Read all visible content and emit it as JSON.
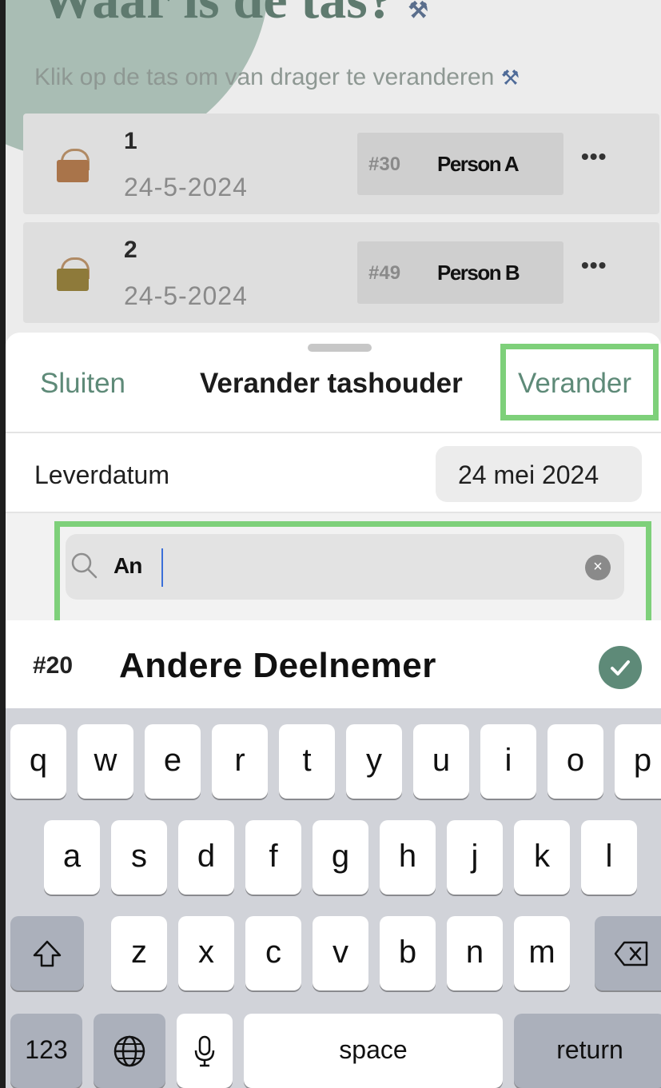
{
  "background": {
    "title": "Waar is de tas?",
    "subtitle": "Klik op de tas om van drager te veranderen",
    "bags": [
      {
        "number": "1",
        "date": "24-5-2024",
        "holder_number": "#30",
        "holder_name": "Person A",
        "color": "#a9744a"
      },
      {
        "number": "2",
        "date": "24-5-2024",
        "holder_number": "#49",
        "holder_name": "Person B",
        "color": "#8e7a3a"
      }
    ],
    "more_label": "•••"
  },
  "sheet": {
    "close_label": "Sluiten",
    "title": "Verander tashouder",
    "change_label": "Verander",
    "delivery_label": "Leverdatum",
    "delivery_date": "24 mei 2024",
    "search_value": "An",
    "clear_label": "×",
    "result": {
      "number": "#20",
      "name": "Andere Deelnemer",
      "selected": true
    }
  },
  "keyboard": {
    "row1": [
      "q",
      "w",
      "e",
      "r",
      "t",
      "y",
      "u",
      "i",
      "o",
      "p"
    ],
    "row2": [
      "a",
      "s",
      "d",
      "f",
      "g",
      "h",
      "j",
      "k",
      "l"
    ],
    "row3": [
      "z",
      "x",
      "c",
      "v",
      "b",
      "n",
      "m"
    ],
    "numbers_label": "123",
    "space_label": "space",
    "return_label": "return"
  },
  "colors": {
    "accent_green": "#5e8a78",
    "highlight_green": "#7ed07a"
  }
}
